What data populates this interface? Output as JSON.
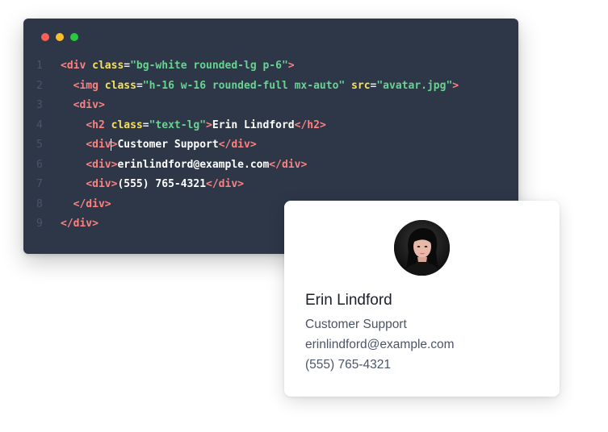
{
  "editor": {
    "window_controls": [
      {
        "name": "close",
        "color": "#fc5f57"
      },
      {
        "name": "minimize",
        "color": "#fdbc2e"
      },
      {
        "name": "maximize",
        "color": "#28c840"
      }
    ],
    "line_numbers": [
      "1",
      "2",
      "3",
      "4",
      "5",
      "6",
      "7",
      "8",
      "9"
    ],
    "code": {
      "l1": {
        "indent": "",
        "open": "<div",
        "attr": "class",
        "eq": "=",
        "value": "\"bg-white rounded-lg p-6\"",
        "close": ">"
      },
      "l2": {
        "indent": "  ",
        "open": "<img",
        "attr1": "class",
        "eq1": "=",
        "value1": "\"h-16 w-16 rounded-full mx-auto\"",
        "attr2": "src",
        "eq2": "=",
        "value2": "\"avatar.jpg\"",
        "close": ">"
      },
      "l3": {
        "indent": "  ",
        "open": "<div",
        "close": ">"
      },
      "l4": {
        "indent": "    ",
        "open": "<h2",
        "attr": "class",
        "eq": "=",
        "value": "\"text-lg\"",
        "gt": ">",
        "text": "Erin Lindford",
        "end_open": "</h2",
        "end_close": ">"
      },
      "l5": {
        "indent": "    ",
        "open": "<div",
        "gt": ">",
        "text": "Customer Support",
        "end_open": "</div",
        "end_close": ">"
      },
      "l6": {
        "indent": "    ",
        "open": "<div",
        "gt": ">",
        "text": "erinlindford@example.com",
        "end_open": "</div",
        "end_close": ">"
      },
      "l7": {
        "indent": "    ",
        "open": "<div",
        "gt": ">",
        "text": "(555) 765-4321",
        "end_open": "</div",
        "end_close": ">"
      },
      "l8": {
        "indent": "  ",
        "open": "</div",
        "close": ">"
      },
      "l9": {
        "indent": "",
        "open": "</div",
        "close": ">"
      }
    },
    "colors": {
      "background": "#2d3748",
      "tag": "#fc8181",
      "attribute": "#f6e05e",
      "string": "#68d391",
      "text": "#ffffff"
    }
  },
  "card": {
    "avatar_icon": "person-photo-icon",
    "name": "Erin Lindford",
    "role": "Customer Support",
    "email": "erinlindford@example.com",
    "phone": "(555) 765-4321"
  }
}
